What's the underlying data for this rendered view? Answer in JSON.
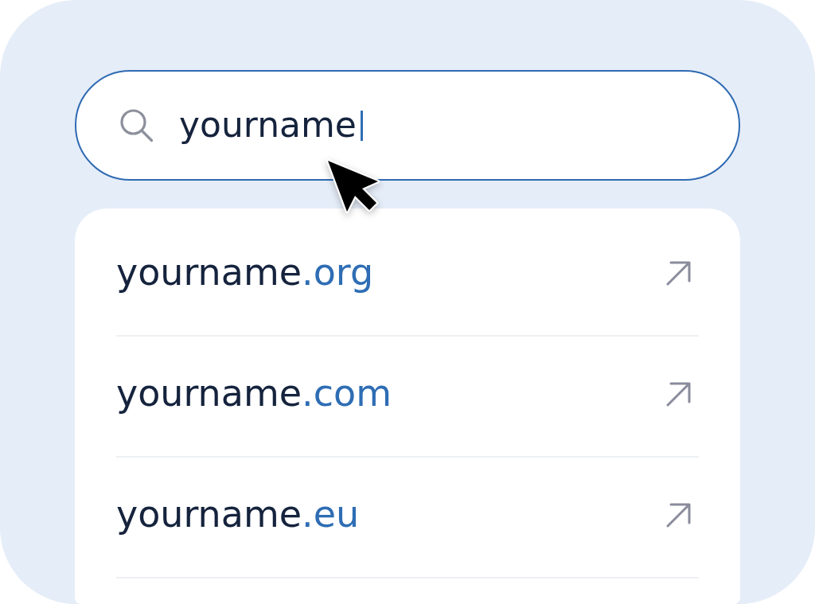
{
  "search": {
    "value": "yourname",
    "focused": true
  },
  "suggestions": [
    {
      "name": "yourname",
      "extension": ".org"
    },
    {
      "name": "yourname",
      "extension": ".com"
    },
    {
      "name": "yourname",
      "extension": ".eu"
    }
  ]
}
